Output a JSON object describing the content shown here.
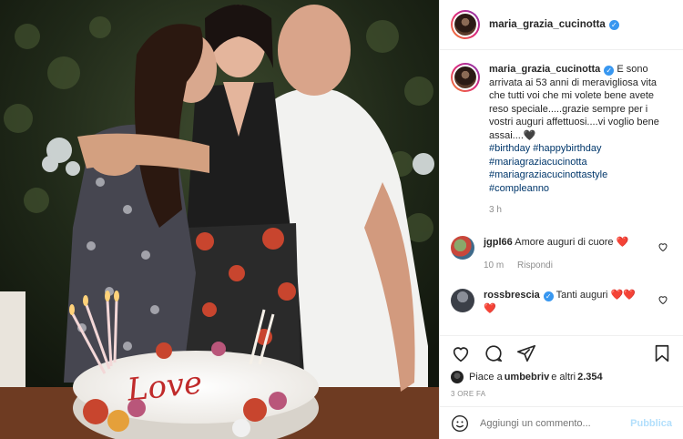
{
  "post": {
    "username": "maria_grazia_cucinotta",
    "verified_icon": "verified-badge-icon",
    "photo_description_icon": "birthday-photo"
  },
  "caption": {
    "username": "maria_grazia_cucinotta",
    "text": "E sono arrivata ai 53 anni di meravigliosa vita che tutti voi che mi volete bene avete reso speciale.....grazie sempre per i vostri auguri affettuosi....vi voglio bene assai....🖤",
    "hashtags": [
      "#birthday #happybirthday",
      "#mariagraziacucinotta",
      "#mariagraziacucinottastyle",
      "#compleanno"
    ],
    "time": "3 h"
  },
  "comments": [
    {
      "username": "jgpl66",
      "text": "Amore auguri di cuore ❤️",
      "time": "10 m",
      "reply_label": "Rispondi"
    },
    {
      "username": "rossbrescia",
      "text": "Tanti auguri ❤️❤️",
      "text2": "❤️"
    }
  ],
  "likes": {
    "prefix": "Piace a ",
    "user": "umbebriv",
    "middle": " e altri ",
    "count": "2.354"
  },
  "posted_ago": "3 ORE FA",
  "add_comment": {
    "placeholder": "Aggiungi un commento...",
    "publish_label": "Pubblica"
  },
  "colors": {
    "link": "#00376b",
    "verified": "#3897f0",
    "publish": "#b2dffc",
    "heart": "#ed4956"
  }
}
